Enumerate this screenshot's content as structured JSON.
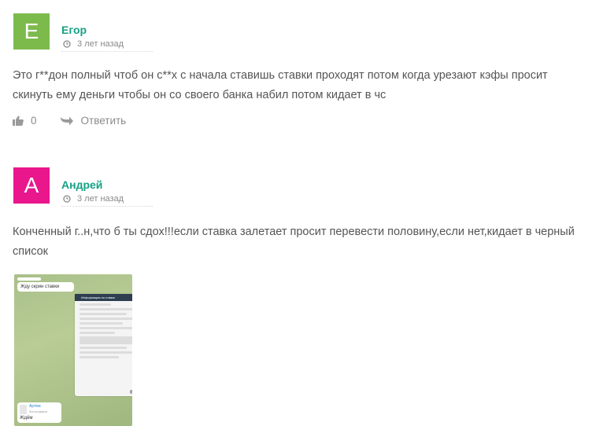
{
  "comments": [
    {
      "avatar_letter": "E",
      "avatar_color": "#7dba4c",
      "author": "Егор",
      "time": "3 лет назад",
      "text": "Это г**дон полный чтоб он с**х с начала ставишь ставки проходят потом когда урезают кэфы просит скинуть ему деньги чтобы он со своего банка набил потом кидает в чс",
      "likes": "0",
      "reply_label": "Ответить"
    },
    {
      "avatar_letter": "А",
      "avatar_color": "#e9168c",
      "author": "Андрей",
      "time": "3 лет назад",
      "text": "Конченный г..н,что б ты сдох!!!если ставка залетает просит перевести половину,если нет,кидает в черный список",
      "attachment": {
        "bubble_top": "Жду скрин ставки",
        "phone_header": "Информация по ставке",
        "bubble_bottom_name": "Артём",
        "bubble_bottom_sub": "Фотография",
        "bubble_bottom_text": "Ждём"
      }
    }
  ],
  "colors": {
    "author": "#16a085",
    "text": "#555555",
    "meta": "#8a8a8a"
  },
  "icons": [
    "clock-icon",
    "thumbs-up-icon",
    "reply-arrow-icon"
  ]
}
